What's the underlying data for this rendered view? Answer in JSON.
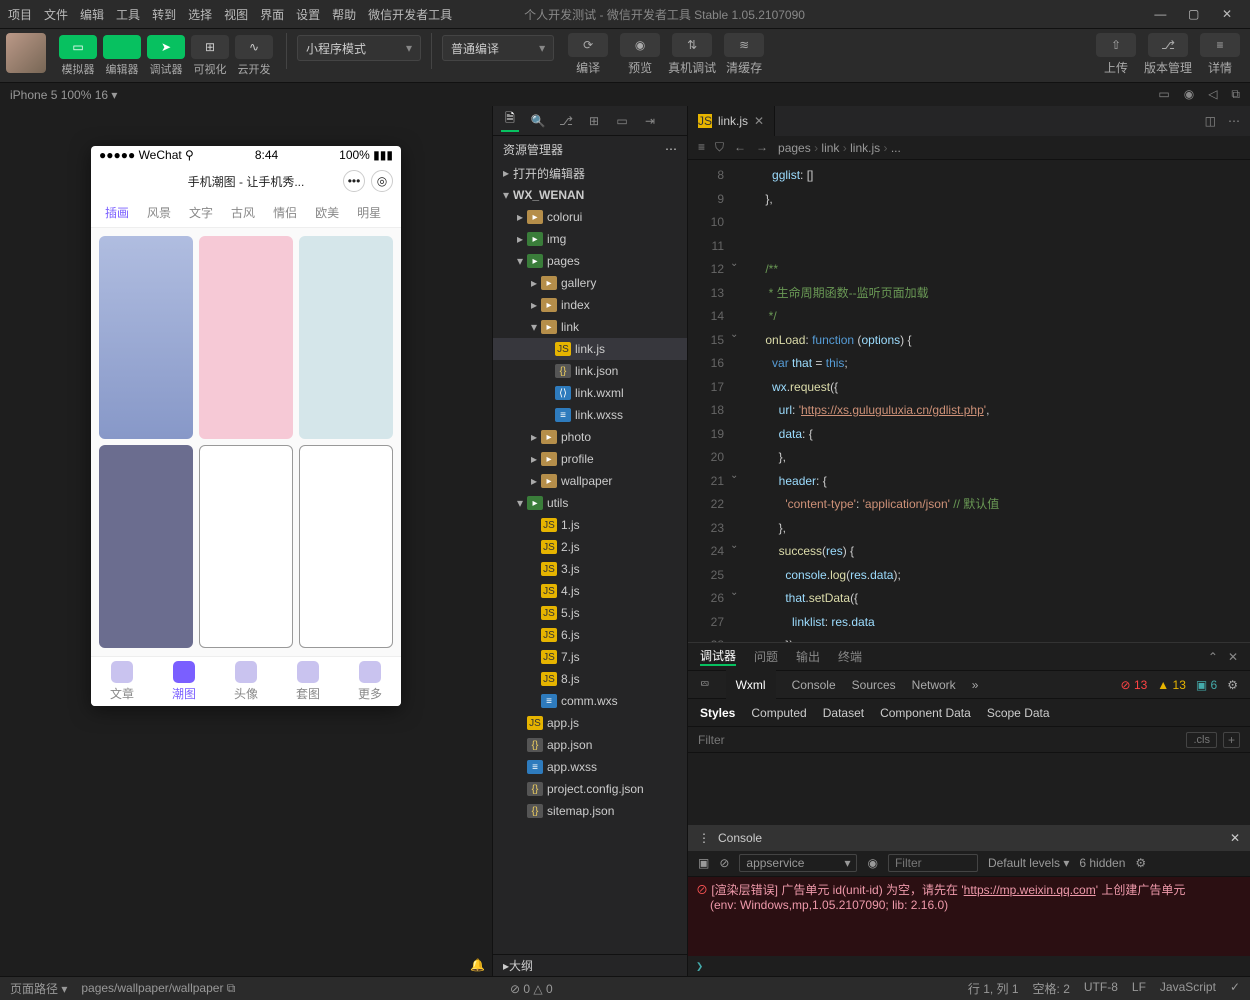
{
  "titlebar": {
    "menus": [
      "项目",
      "文件",
      "编辑",
      "工具",
      "转到",
      "选择",
      "视图",
      "界面",
      "设置",
      "帮助",
      "微信开发者工具"
    ],
    "title": "个人开发测试 - 微信开发者工具 Stable 1.05.2107090"
  },
  "toolbar": {
    "tools": [
      {
        "label": "模拟器",
        "green": true,
        "icon": "▭"
      },
      {
        "label": "编辑器",
        "green": true,
        "icon": "</>"
      },
      {
        "label": "调试器",
        "green": true,
        "icon": "➤"
      },
      {
        "label": "可视化",
        "green": false,
        "icon": "⊞"
      },
      {
        "label": "云开发",
        "green": false,
        "icon": "∿"
      }
    ],
    "dropdown1": "小程序模式",
    "dropdown2": "普通编译",
    "mid": [
      {
        "label": "编译",
        "icon": "⟳"
      },
      {
        "label": "预览",
        "icon": "◉"
      },
      {
        "label": "真机调试",
        "icon": "⇅"
      },
      {
        "label": "清缓存",
        "icon": "≋"
      }
    ],
    "right": [
      {
        "label": "上传",
        "icon": "⇧"
      },
      {
        "label": "版本管理",
        "icon": "⎇"
      },
      {
        "label": "详情",
        "icon": "≡"
      }
    ]
  },
  "devrow": {
    "device": "iPhone 5 100% 16 ▾",
    "icons": [
      "▭",
      "◉",
      "◁",
      "⧉"
    ]
  },
  "phone": {
    "carrier": "●●●●● WeChat ⚲",
    "time": "8:44",
    "battery": "100% ▮▮▮",
    "title": "手机潮图 - 让手机秀...",
    "tabs": [
      "插画",
      "风景",
      "文字",
      "古风",
      "情侣",
      "欧美",
      "明星"
    ],
    "nav": [
      "文章",
      "潮图",
      "头像",
      "套图",
      "更多"
    ],
    "navActive": 1
  },
  "explorer": {
    "header": "资源管理器",
    "sections": [
      "打开的编辑器",
      "WX_WENAN"
    ],
    "tree": [
      {
        "d": 1,
        "t": "folder",
        "n": "colorui"
      },
      {
        "d": 1,
        "t": "folderg",
        "n": "img"
      },
      {
        "d": 1,
        "t": "folderg",
        "n": "pages",
        "open": true
      },
      {
        "d": 2,
        "t": "folder",
        "n": "gallery"
      },
      {
        "d": 2,
        "t": "folder",
        "n": "index"
      },
      {
        "d": 2,
        "t": "folder",
        "n": "link",
        "open": true
      },
      {
        "d": 3,
        "t": "js",
        "n": "link.js",
        "sel": true
      },
      {
        "d": 3,
        "t": "json",
        "n": "link.json"
      },
      {
        "d": 3,
        "t": "wxml",
        "n": "link.wxml"
      },
      {
        "d": 3,
        "t": "wxss",
        "n": "link.wxss"
      },
      {
        "d": 2,
        "t": "folder",
        "n": "photo"
      },
      {
        "d": 2,
        "t": "folder",
        "n": "profile"
      },
      {
        "d": 2,
        "t": "folder",
        "n": "wallpaper"
      },
      {
        "d": 1,
        "t": "folderg",
        "n": "utils",
        "open": true
      },
      {
        "d": 2,
        "t": "js",
        "n": "1.js"
      },
      {
        "d": 2,
        "t": "js",
        "n": "2.js"
      },
      {
        "d": 2,
        "t": "js",
        "n": "3.js"
      },
      {
        "d": 2,
        "t": "js",
        "n": "4.js"
      },
      {
        "d": 2,
        "t": "js",
        "n": "5.js"
      },
      {
        "d": 2,
        "t": "js",
        "n": "6.js"
      },
      {
        "d": 2,
        "t": "js",
        "n": "7.js"
      },
      {
        "d": 2,
        "t": "js",
        "n": "8.js"
      },
      {
        "d": 2,
        "t": "wxss",
        "n": "comm.wxs"
      },
      {
        "d": 1,
        "t": "js",
        "n": "app.js"
      },
      {
        "d": 1,
        "t": "json",
        "n": "app.json"
      },
      {
        "d": 1,
        "t": "wxss",
        "n": "app.wxss"
      },
      {
        "d": 1,
        "t": "json",
        "n": "project.config.json"
      },
      {
        "d": 1,
        "t": "json",
        "n": "sitemap.json"
      }
    ],
    "outline": "大纲"
  },
  "editor": {
    "tab": "link.js",
    "breadcrumb": [
      "pages",
      "link",
      "link.js",
      "..."
    ],
    "code": {
      "start": 8,
      "lines": [
        {
          "h": "      <span class='c-p'>gglist</span>: []"
        },
        {
          "h": "    },"
        },
        {
          "h": ""
        },
        {
          "h": ""
        },
        {
          "h": "    <span class='c-c'>/**</span>"
        },
        {
          "h": "    <span class='c-c'> * 生命周期函数--监听页面加载</span>"
        },
        {
          "h": "    <span class='c-c'> */</span>"
        },
        {
          "h": "    <span class='c-f'>onLoad</span>: <span class='c-k'>function</span> (<span class='c-p'>options</span>) {"
        },
        {
          "h": "      <span class='c-k'>var</span> <span class='c-p'>that</span> = <span class='c-k'>this</span>;"
        },
        {
          "h": "      <span class='c-p'>wx</span>.<span class='c-f'>request</span>({"
        },
        {
          "h": "        <span class='c-p'>url</span>: <span class='c-s'>'</span><span class='c-url'>https://xs.guluguluxia.cn/gdlist.php</span><span class='c-s'>'</span>,"
        },
        {
          "h": "        <span class='c-p'>data</span>: {"
        },
        {
          "h": "        },"
        },
        {
          "h": "        <span class='c-p'>header</span>: {"
        },
        {
          "h": "          <span class='c-s'>'content-type'</span>: <span class='c-s'>'application/json'</span> <span class='c-c'>// 默认值</span>"
        },
        {
          "h": "        },"
        },
        {
          "h": "        <span class='c-f'>success</span>(<span class='c-p'>res</span>) {"
        },
        {
          "h": "          <span class='c-p'>console</span>.<span class='c-f'>log</span>(<span class='c-p'>res</span>.<span class='c-p'>data</span>);"
        },
        {
          "h": "          <span class='c-p'>that</span>.<span class='c-f'>setData</span>({"
        },
        {
          "h": "            <span class='c-p'>linklist</span>: <span class='c-p'>res</span>.<span class='c-p'>data</span>"
        },
        {
          "h": "          });"
        },
        {
          "h": "        }"
        },
        {
          "h": "      })"
        }
      ]
    }
  },
  "panels": {
    "ptabs": [
      "调试器",
      "问题",
      "输出",
      "终端"
    ],
    "dbgTabs": [
      "Wxml",
      "Console",
      "Sources",
      "Network"
    ],
    "counts": {
      "err": "13",
      "warn": "13",
      "info": "6"
    },
    "stylesTabs": [
      "Styles",
      "Computed",
      "Dataset",
      "Component Data",
      "Scope Data"
    ],
    "filter": "Filter",
    "cls": ".cls",
    "consoleTitle": "Console",
    "consService": "appservice",
    "consFilter": "Filter",
    "consLevels": "Default levels ▾",
    "consHidden": "6 hidden",
    "consLine1a": "[渲染层错误] 广告单元 id(unit-id) 为空，请先在 '",
    "consLink": "https://mp.weixin.qq.com",
    "consLine1b": "' 上创建广告单元",
    "consLine2": "(env: Windows,mp,1.05.2107090; lib: 2.16.0)"
  },
  "status": {
    "left": [
      "页面路径 ▾",
      "pages/wallpaper/wallpaper ⧉"
    ],
    "midIcons": "⊘ 0 △ 0",
    "right": [
      "行 1, 列 1",
      "空格: 2",
      "UTF-8",
      "LF",
      "JavaScript",
      "✓"
    ]
  }
}
